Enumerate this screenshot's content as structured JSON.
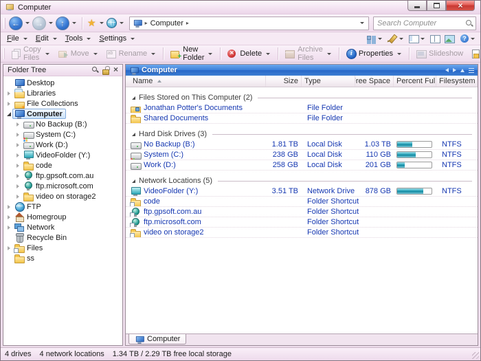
{
  "window": {
    "title": "Computer"
  },
  "navbar": {
    "breadcrumb": {
      "location": "Computer"
    },
    "search": {
      "placeholder": "Search Computer"
    }
  },
  "menubar": {
    "items": [
      "File",
      "Edit",
      "Tools",
      "Settings"
    ],
    "right_buttons": [
      {
        "name": "view-mode",
        "dropdown": true
      },
      {
        "name": "edit-pen",
        "dropdown": true
      },
      {
        "name": "folder-format",
        "dropdown": true
      },
      {
        "name": "dual-pane",
        "dropdown": false
      },
      {
        "name": "viewer-pane",
        "dropdown": false
      },
      {
        "name": "help",
        "dropdown": true
      }
    ]
  },
  "toolbar": {
    "buttons": [
      {
        "label": "Copy Files",
        "icon": "copy",
        "enabled": false,
        "dropdown": true,
        "sep_before": false
      },
      {
        "label": "Move",
        "icon": "move",
        "enabled": false,
        "dropdown": true,
        "sep_before": false
      },
      {
        "label": "Rename",
        "icon": "rename",
        "enabled": false,
        "dropdown": true,
        "sep_before": false
      },
      {
        "label": "New Folder",
        "icon": "new-folder",
        "enabled": true,
        "dropdown": true,
        "sep_before": true
      },
      {
        "label": "Delete",
        "icon": "delete",
        "enabled": true,
        "dropdown": true,
        "sep_before": true
      },
      {
        "label": "Archive Files",
        "icon": "archive",
        "enabled": false,
        "dropdown": true,
        "sep_before": true
      },
      {
        "label": "Properties",
        "icon": "properties",
        "enabled": true,
        "dropdown": true,
        "sep_before": true
      },
      {
        "label": "Slideshow",
        "icon": "slideshow",
        "enabled": false,
        "dropdown": false,
        "sep_before": true
      }
    ]
  },
  "tree": {
    "title": "Folder Tree",
    "items": [
      {
        "label": "Desktop",
        "icon": "desktop",
        "level": 0,
        "expander": "none",
        "selected": false
      },
      {
        "label": "Libraries",
        "icon": "libraries",
        "level": 0,
        "expander": "collapsed",
        "selected": false
      },
      {
        "label": "File Collections",
        "icon": "collections",
        "level": 0,
        "expander": "collapsed",
        "selected": false
      },
      {
        "label": "Computer",
        "icon": "computer",
        "level": 0,
        "expander": "expanded",
        "selected": true
      },
      {
        "label": "No Backup (B:)",
        "icon": "drive",
        "level": 1,
        "expander": "collapsed",
        "selected": false
      },
      {
        "label": "System (C:)",
        "icon": "drive-system",
        "level": 1,
        "expander": "collapsed",
        "selected": false
      },
      {
        "label": "Work (D:)",
        "icon": "drive",
        "level": 1,
        "expander": "collapsed",
        "selected": false
      },
      {
        "label": "VideoFolder (Y:)",
        "icon": "network-drive",
        "level": 1,
        "expander": "collapsed",
        "selected": false
      },
      {
        "label": "code",
        "icon": "folder",
        "level": 1,
        "expander": "collapsed",
        "selected": false
      },
      {
        "label": "ftp.gpsoft.com.au",
        "icon": "ftp",
        "level": 1,
        "expander": "collapsed",
        "selected": false
      },
      {
        "label": "ftp.microsoft.com",
        "icon": "ftp",
        "level": 1,
        "expander": "collapsed",
        "selected": false
      },
      {
        "label": "video on storage2",
        "icon": "folder",
        "level": 1,
        "expander": "collapsed",
        "selected": false
      },
      {
        "label": "FTP",
        "icon": "globe",
        "level": 0,
        "expander": "collapsed",
        "selected": false
      },
      {
        "label": "Homegroup",
        "icon": "homegroup",
        "level": 0,
        "expander": "collapsed",
        "selected": false
      },
      {
        "label": "Network",
        "icon": "network",
        "level": 0,
        "expander": "collapsed",
        "selected": false
      },
      {
        "label": "Recycle Bin",
        "icon": "recycle",
        "level": 0,
        "expander": "none",
        "selected": false
      },
      {
        "label": "Files",
        "icon": "folder-shortcut",
        "level": 0,
        "expander": "collapsed",
        "selected": false
      },
      {
        "label": "ss",
        "icon": "folder",
        "level": 0,
        "expander": "none",
        "selected": false
      }
    ]
  },
  "filepanel": {
    "title": "Computer",
    "columns": [
      "Name",
      "Size",
      "Type",
      "Free Space",
      "Percent Full",
      "Filesystem"
    ],
    "sort_column": "Name",
    "sections": [
      {
        "label": "Files Stored on This Computer (2)",
        "rows": [
          {
            "name": "Jonathan Potter's Documents",
            "icon": "folder-docs",
            "size": "",
            "type": "File Folder",
            "free": "",
            "percent": null,
            "fs": ""
          },
          {
            "name": "Shared Documents",
            "icon": "folder",
            "size": "",
            "type": "File Folder",
            "free": "",
            "percent": null,
            "fs": ""
          }
        ]
      },
      {
        "label": "Hard Disk Drives (3)",
        "rows": [
          {
            "name": "No Backup (B:)",
            "icon": "drive",
            "size": "1.81 TB",
            "type": "Local Disk",
            "free": "1.03 TB",
            "percent": 43,
            "fs": "NTFS"
          },
          {
            "name": "System (C:)",
            "icon": "drive-system",
            "size": "238 GB",
            "type": "Local Disk",
            "free": "110 GB",
            "percent": 54,
            "fs": "NTFS"
          },
          {
            "name": "Work (D:)",
            "icon": "drive",
            "size": "258 GB",
            "type": "Local Disk",
            "free": "201 GB",
            "percent": 22,
            "fs": "NTFS"
          }
        ]
      },
      {
        "label": "Network Locations (5)",
        "rows": [
          {
            "name": "VideoFolder (Y:)",
            "icon": "network-drive",
            "size": "3.51 TB",
            "type": "Network Drive",
            "free": "878 GB",
            "percent": 75,
            "fs": "NTFS"
          },
          {
            "name": "code",
            "icon": "folder-shortcut",
            "size": "",
            "type": "Folder Shortcut",
            "free": "",
            "percent": null,
            "fs": ""
          },
          {
            "name": "ftp.gpsoft.com.au",
            "icon": "ftp-shortcut",
            "size": "",
            "type": "Folder Shortcut",
            "free": "",
            "percent": null,
            "fs": ""
          },
          {
            "name": "ftp.microsoft.com",
            "icon": "ftp-shortcut",
            "size": "",
            "type": "Folder Shortcut",
            "free": "",
            "percent": null,
            "fs": ""
          },
          {
            "name": "video on storage2",
            "icon": "folder-shortcut",
            "size": "",
            "type": "Folder Shortcut",
            "free": "",
            "percent": null,
            "fs": ""
          }
        ]
      }
    ],
    "tab": {
      "label": "Computer"
    }
  },
  "statusbar": {
    "parts": [
      "4 drives",
      "4 network locations",
      "1.34 TB / 2.29 TB free local storage"
    ]
  },
  "colors": {
    "panel_header_blue": "#3c80da",
    "percent_bar_teal": "#2aa5ba",
    "row_text_blue": "#1537b1",
    "chrome_pink": "#efdced",
    "close_button_red": "#d8544a"
  }
}
